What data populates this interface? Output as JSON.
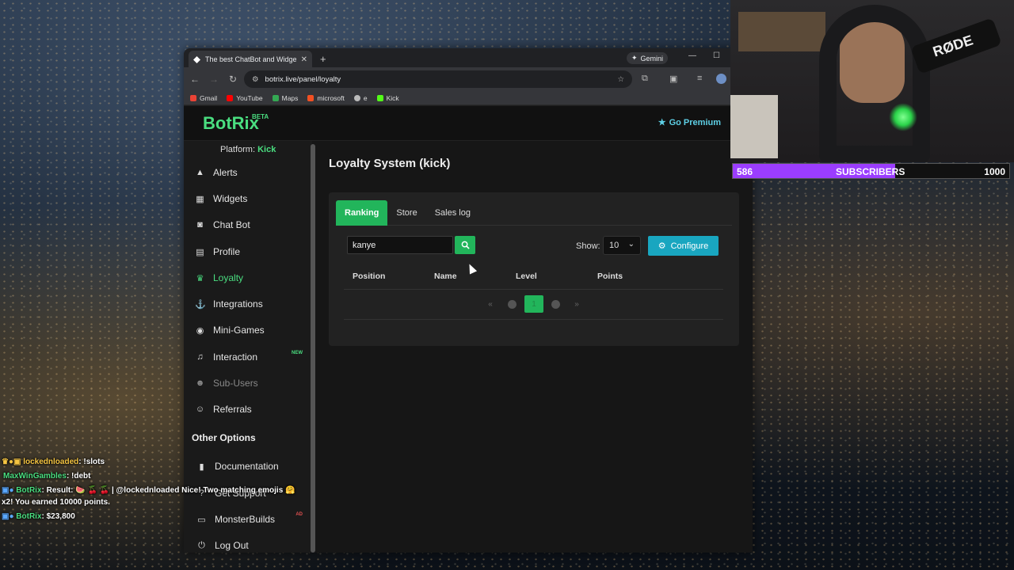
{
  "browser": {
    "tab_title": "The best ChatBot and Widgets",
    "tab_close": "✕",
    "new_tab": "+",
    "gemini_label": "Gemini",
    "url": "botrix.live/panel/loyalty",
    "bookmarks": [
      {
        "label": "Gmail",
        "color": "#ea4335"
      },
      {
        "label": "YouTube",
        "color": "#ff0000"
      },
      {
        "label": "Maps",
        "color": "#34a853"
      },
      {
        "label": "microsoft",
        "color": "#f25022"
      },
      {
        "label": "e",
        "color": "#bbbbbb"
      },
      {
        "label": "Kick",
        "color": "#53fc18"
      }
    ]
  },
  "header": {
    "logo": "BotRix",
    "beta": "BETA",
    "premium": "Go Premium"
  },
  "sidebar": {
    "platform_label": "Platform:",
    "platform_value": "Kick",
    "items": [
      {
        "label": "Alerts",
        "icon": "warning-icon"
      },
      {
        "label": "Widgets",
        "icon": "grid-icon"
      },
      {
        "label": "Chat Bot",
        "icon": "robot-icon"
      },
      {
        "label": "Profile",
        "icon": "id-card-icon"
      },
      {
        "label": "Loyalty",
        "icon": "trophy-icon"
      },
      {
        "label": "Integrations",
        "icon": "plug-icon"
      },
      {
        "label": "Mini-Games",
        "icon": "gamepad-icon"
      },
      {
        "label": "Interaction",
        "icon": "music-icon",
        "badge": "NEW"
      },
      {
        "label": "Sub-Users",
        "icon": "users-icon"
      },
      {
        "label": "Referrals",
        "icon": "user-plus-icon"
      }
    ],
    "other_heading": "Other Options",
    "other_items": [
      {
        "label": "Documentation",
        "icon": "book-icon"
      },
      {
        "label": "Get Support",
        "icon": "question-icon"
      },
      {
        "label": "MonsterBuilds",
        "icon": "laptop-icon",
        "badge": "AD"
      },
      {
        "label": "Log Out",
        "icon": "logout-icon"
      }
    ],
    "accent": "#4ade80"
  },
  "main": {
    "title": "Loyalty System (kick)",
    "tabs": [
      "Ranking",
      "Store",
      "Sales log"
    ],
    "search_value": "kanye",
    "show_label": "Show:",
    "show_value": "10",
    "configure_label": "Configure",
    "columns": [
      "Position",
      "Name",
      "Level",
      "Points"
    ],
    "pagination": [
      "«",
      "‹",
      "1",
      "›",
      "»"
    ]
  },
  "overlay": {
    "subscribers_current": "586",
    "subscribers_label": "SUBSCRIBERS",
    "subscribers_goal": "1000",
    "subscribers_progress": 0.586,
    "mic_brand": "RØDE",
    "chat": [
      {
        "user": "lockednloaded",
        "text": ": !slots"
      },
      {
        "user": "MaxWinGambles",
        "text": ": !debt"
      },
      {
        "user": "BotRix",
        "text": ": Result: 🍉 🍒 🍒 | @lockednloaded Nice! Two matching emojis 🤗"
      },
      {
        "user": "",
        "text": "x2! You earned 10000 points."
      },
      {
        "user": "BotRix",
        "text": ": $23,800"
      }
    ]
  }
}
